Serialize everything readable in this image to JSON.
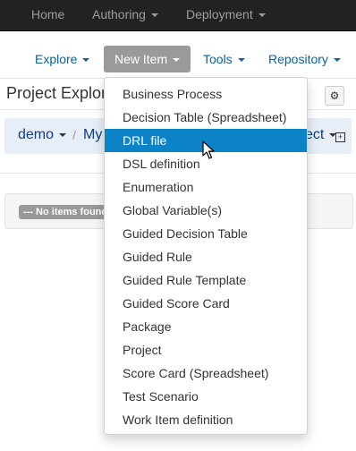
{
  "topbar": {
    "items": [
      "Home",
      "Authoring",
      "Deployment"
    ]
  },
  "toolbar": {
    "explore": "Explore",
    "new_item": "New Item",
    "tools": "Tools",
    "repository": "Repository"
  },
  "explorer": {
    "title": "Project Explorer",
    "breadcrumb": [
      "demo",
      "My",
      "ect"
    ],
    "empty_badge": "--- No items found"
  },
  "menu": {
    "items": [
      "Business Process",
      "Decision Table (Spreadsheet)",
      "DRL file",
      "DSL definition",
      "Enumeration",
      "Global Variable(s)",
      "Guided Decision Table",
      "Guided Rule",
      "Guided Rule Template",
      "Guided Score Card",
      "Package",
      "Project",
      "Score Card (Spreadsheet)",
      "Test Scenario",
      "Work Item definition"
    ],
    "highlighted_index": 2
  },
  "colors": {
    "navbar": "#222222",
    "link": "#0b62a4",
    "highlight": "#0c83c6",
    "active_button": "#9a9a9a"
  }
}
